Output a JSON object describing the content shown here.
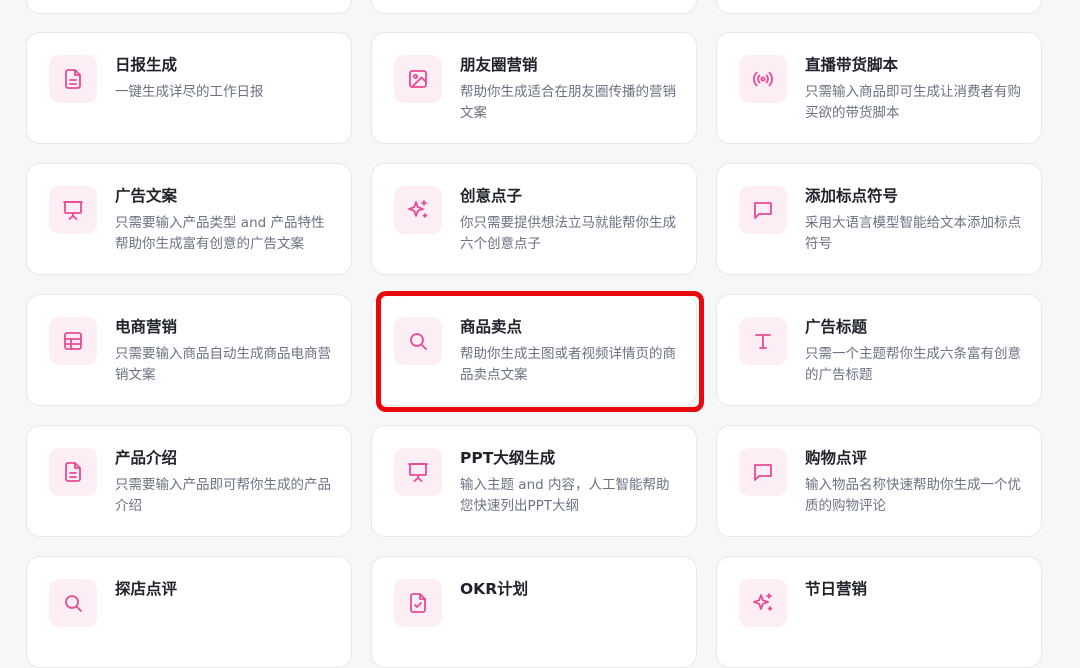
{
  "cards": [
    {
      "title": "日报生成",
      "desc": "一键生成详尽的工作日报",
      "icon": "document-icon"
    },
    {
      "title": "朋友圈营销",
      "desc": "帮助你生成适合在朋友圈传播的营销文案",
      "icon": "image-icon"
    },
    {
      "title": "直播带货脚本",
      "desc": "只需输入商品即可生成让消费者有购买欲的带货脚本",
      "icon": "broadcast-icon"
    },
    {
      "title": "广告文案",
      "desc": "只需要输入产品类型 and 产品特性帮助你生成富有创意的广告文案",
      "icon": "presentation-icon"
    },
    {
      "title": "创意点子",
      "desc": "你只需要提供想法立马就能帮你生成六个创意点子",
      "icon": "sparkles-icon"
    },
    {
      "title": "添加标点符号",
      "desc": "采用大语言模型智能给文本添加标点符号",
      "icon": "message-icon"
    },
    {
      "title": "电商营销",
      "desc": "只需要输入商品自动生成商品电商营销文案",
      "icon": "grid-icon"
    },
    {
      "title": "商品卖点",
      "desc": "帮助你生成主图或者视频详情页的商品卖点文案",
      "icon": "search-icon"
    },
    {
      "title": "广告标题",
      "desc": "只需一个主题帮你生成六条富有创意的广告标题",
      "icon": "type-icon"
    },
    {
      "title": "产品介绍",
      "desc": "只需要输入产品即可帮你生成的产品介绍",
      "icon": "document-icon"
    },
    {
      "title": "PPT大纲生成",
      "desc": "输入主题 and 内容，人工智能帮助您快速列出PPT大纲",
      "icon": "presentation-icon"
    },
    {
      "title": "购物点评",
      "desc": "输入物品名称快速帮助你生成一个优质的购物评论",
      "icon": "message-icon"
    },
    {
      "title": "探店点评",
      "desc": "",
      "icon": "search-icon"
    },
    {
      "title": "OKR计划",
      "desc": "",
      "icon": "checklist-icon"
    },
    {
      "title": "节日营销",
      "desc": "",
      "icon": "sparkles-icon"
    }
  ],
  "colors": {
    "accent": "#e64b93",
    "icon_bg": "#fdeef5",
    "highlight": "#e8090c"
  }
}
